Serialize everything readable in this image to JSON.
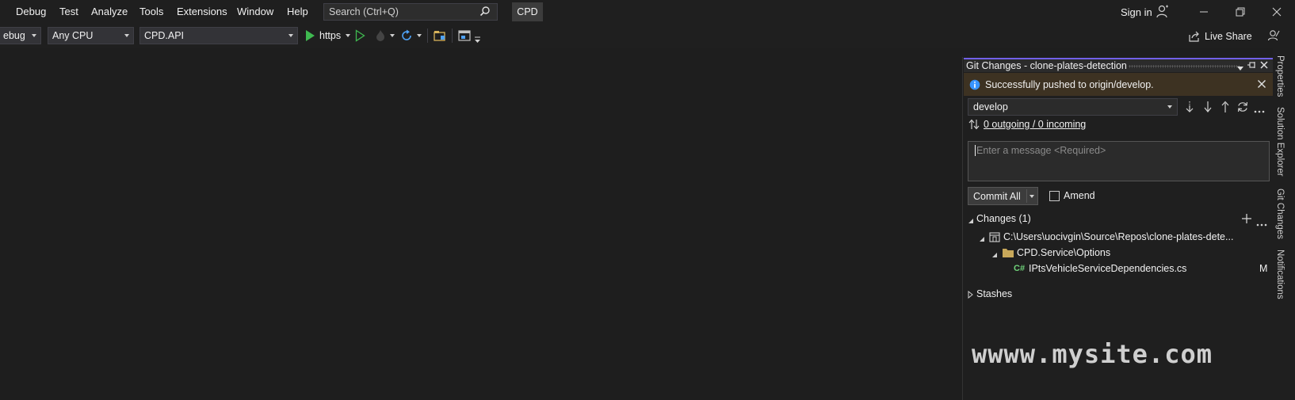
{
  "menu": {
    "items": [
      "Debug",
      "Test",
      "Analyze",
      "Tools",
      "Extensions",
      "Window",
      "Help"
    ],
    "search_placeholder": "Search (Ctrl+Q)",
    "solution_badge": "CPD",
    "sign_in": "Sign in"
  },
  "toolbar": {
    "configuration": "ebug",
    "platform": "Any CPU",
    "startup_project": "CPD.API",
    "run_profile": "https",
    "live_share": "Live Share"
  },
  "git_panel": {
    "title": "Git Changes - clone-plates-detection",
    "info_message": "Successfully pushed to origin/develop.",
    "branch": "develop",
    "sync_status": "0 outgoing / 0 incoming",
    "message_placeholder": "Enter a message <Required>",
    "commit_button": "Commit All",
    "amend_label": "Amend",
    "amend_checked": false,
    "changes_header": "Changes (1)",
    "repo_path": "C:\\Users\\uocivgin\\Source\\Repos\\clone-plates-dete...",
    "folder": "CPD.Service\\Options",
    "file_icon_text": "C#",
    "file_name": "IPtsVehicleServiceDependencies.cs",
    "file_status": "M",
    "stashes_header": "Stashes",
    "accent_color": "#7160e8"
  },
  "watermark": "wwww.mysite.com",
  "side_tabs": [
    "Properties",
    "Solution Explorer",
    "Git Changes",
    "Notifications"
  ]
}
